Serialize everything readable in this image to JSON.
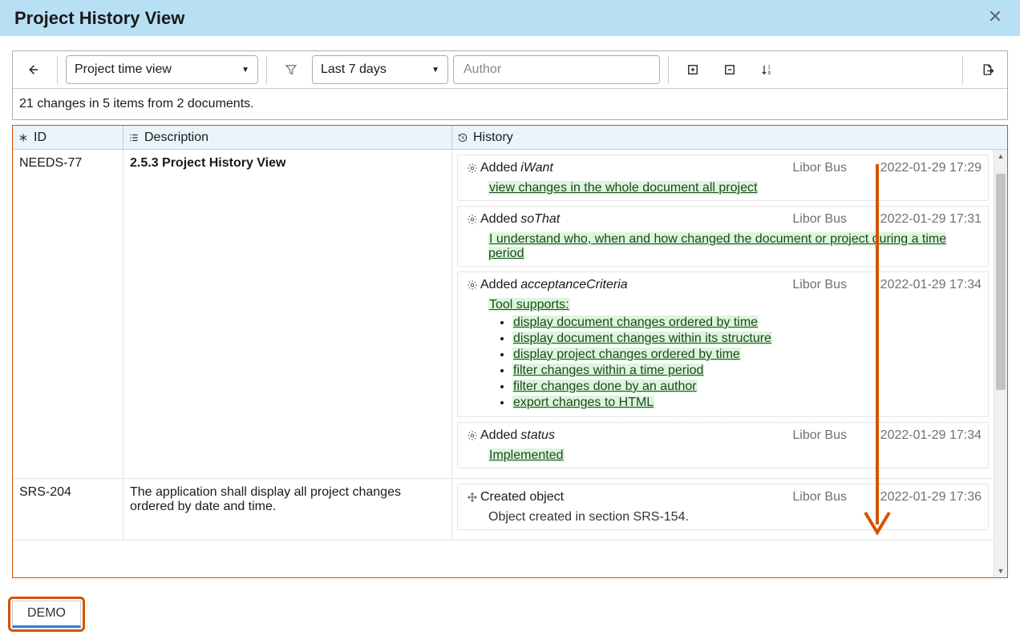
{
  "title": "Project History View",
  "toolbar": {
    "view_select": "Project time view",
    "period_select": "Last 7 days",
    "author_placeholder": "Author"
  },
  "summary": "21 changes in 5 items from 2 documents.",
  "columns": {
    "id": "ID",
    "description": "Description",
    "history": "History"
  },
  "rows": [
    {
      "id": "NEEDS-77",
      "description": "2.5.3 Project History View",
      "description_bold": true,
      "history": [
        {
          "icon": "gear",
          "action": "Added",
          "field": "iWant",
          "author": "Libor Bus",
          "date": "2022-01-29 17:29",
          "content_type": "text",
          "text": "view changes in the whole document all project"
        },
        {
          "icon": "gear",
          "action": "Added",
          "field": "soThat",
          "author": "Libor Bus",
          "date": "2022-01-29 17:31",
          "content_type": "text",
          "text": "I understand who, when and how changed the document or project during a time period"
        },
        {
          "icon": "gear",
          "action": "Added",
          "field": "acceptanceCriteria",
          "author": "Libor Bus",
          "date": "2022-01-29 17:34",
          "content_type": "list",
          "intro": "Tool supports:",
          "items": [
            "display document changes ordered by time",
            "display document changes within its structure",
            "display project changes ordered by time",
            "filter changes within a time period",
            "filter changes done by an author",
            "export changes to HTML"
          ]
        },
        {
          "icon": "gear",
          "action": "Added",
          "field": "status",
          "author": "Libor Bus",
          "date": "2022-01-29 17:34",
          "content_type": "text",
          "text": "Implemented"
        }
      ]
    },
    {
      "id": "SRS-204",
      "description": "The application shall display all project changes ordered by date and time.",
      "description_bold": false,
      "history": [
        {
          "icon": "move",
          "action": "Created object",
          "field": "",
          "author": "Libor Bus",
          "date": "2022-01-29 17:36",
          "content_type": "plain",
          "text": "Object created in section SRS-154."
        }
      ]
    }
  ],
  "footer_tab": "DEMO"
}
